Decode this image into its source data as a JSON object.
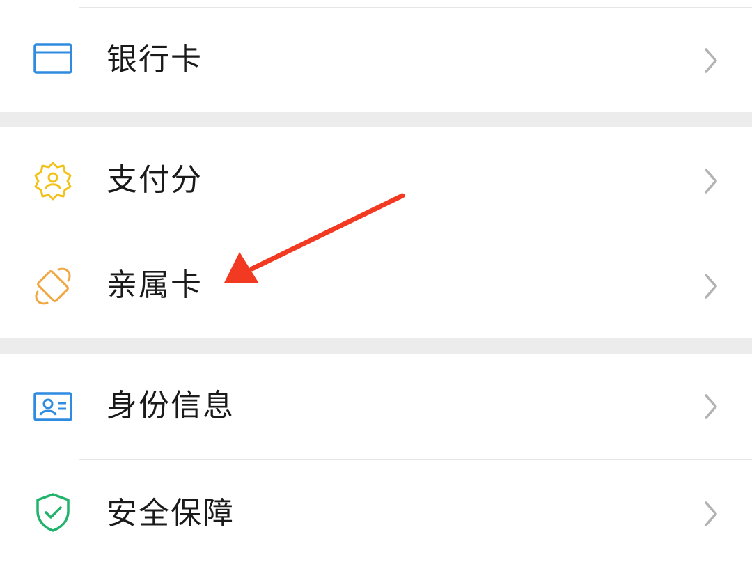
{
  "menu": {
    "items": [
      {
        "label": "银行卡",
        "icon": "bank-card-icon",
        "icon_color": "#2f8be0"
      },
      {
        "label": "支付分",
        "icon": "payment-score-badge-icon",
        "icon_color": "#f2c21b"
      },
      {
        "label": "亲属卡",
        "icon": "family-card-icon",
        "icon_color": "#f0a845"
      },
      {
        "label": "身份信息",
        "icon": "id-card-icon",
        "icon_color": "#2f8be0"
      },
      {
        "label": "安全保障",
        "icon": "security-shield-icon",
        "icon_color": "#21b36b"
      }
    ]
  },
  "annotation": {
    "type": "arrow",
    "color": "#f23a22",
    "target": "亲属卡"
  }
}
